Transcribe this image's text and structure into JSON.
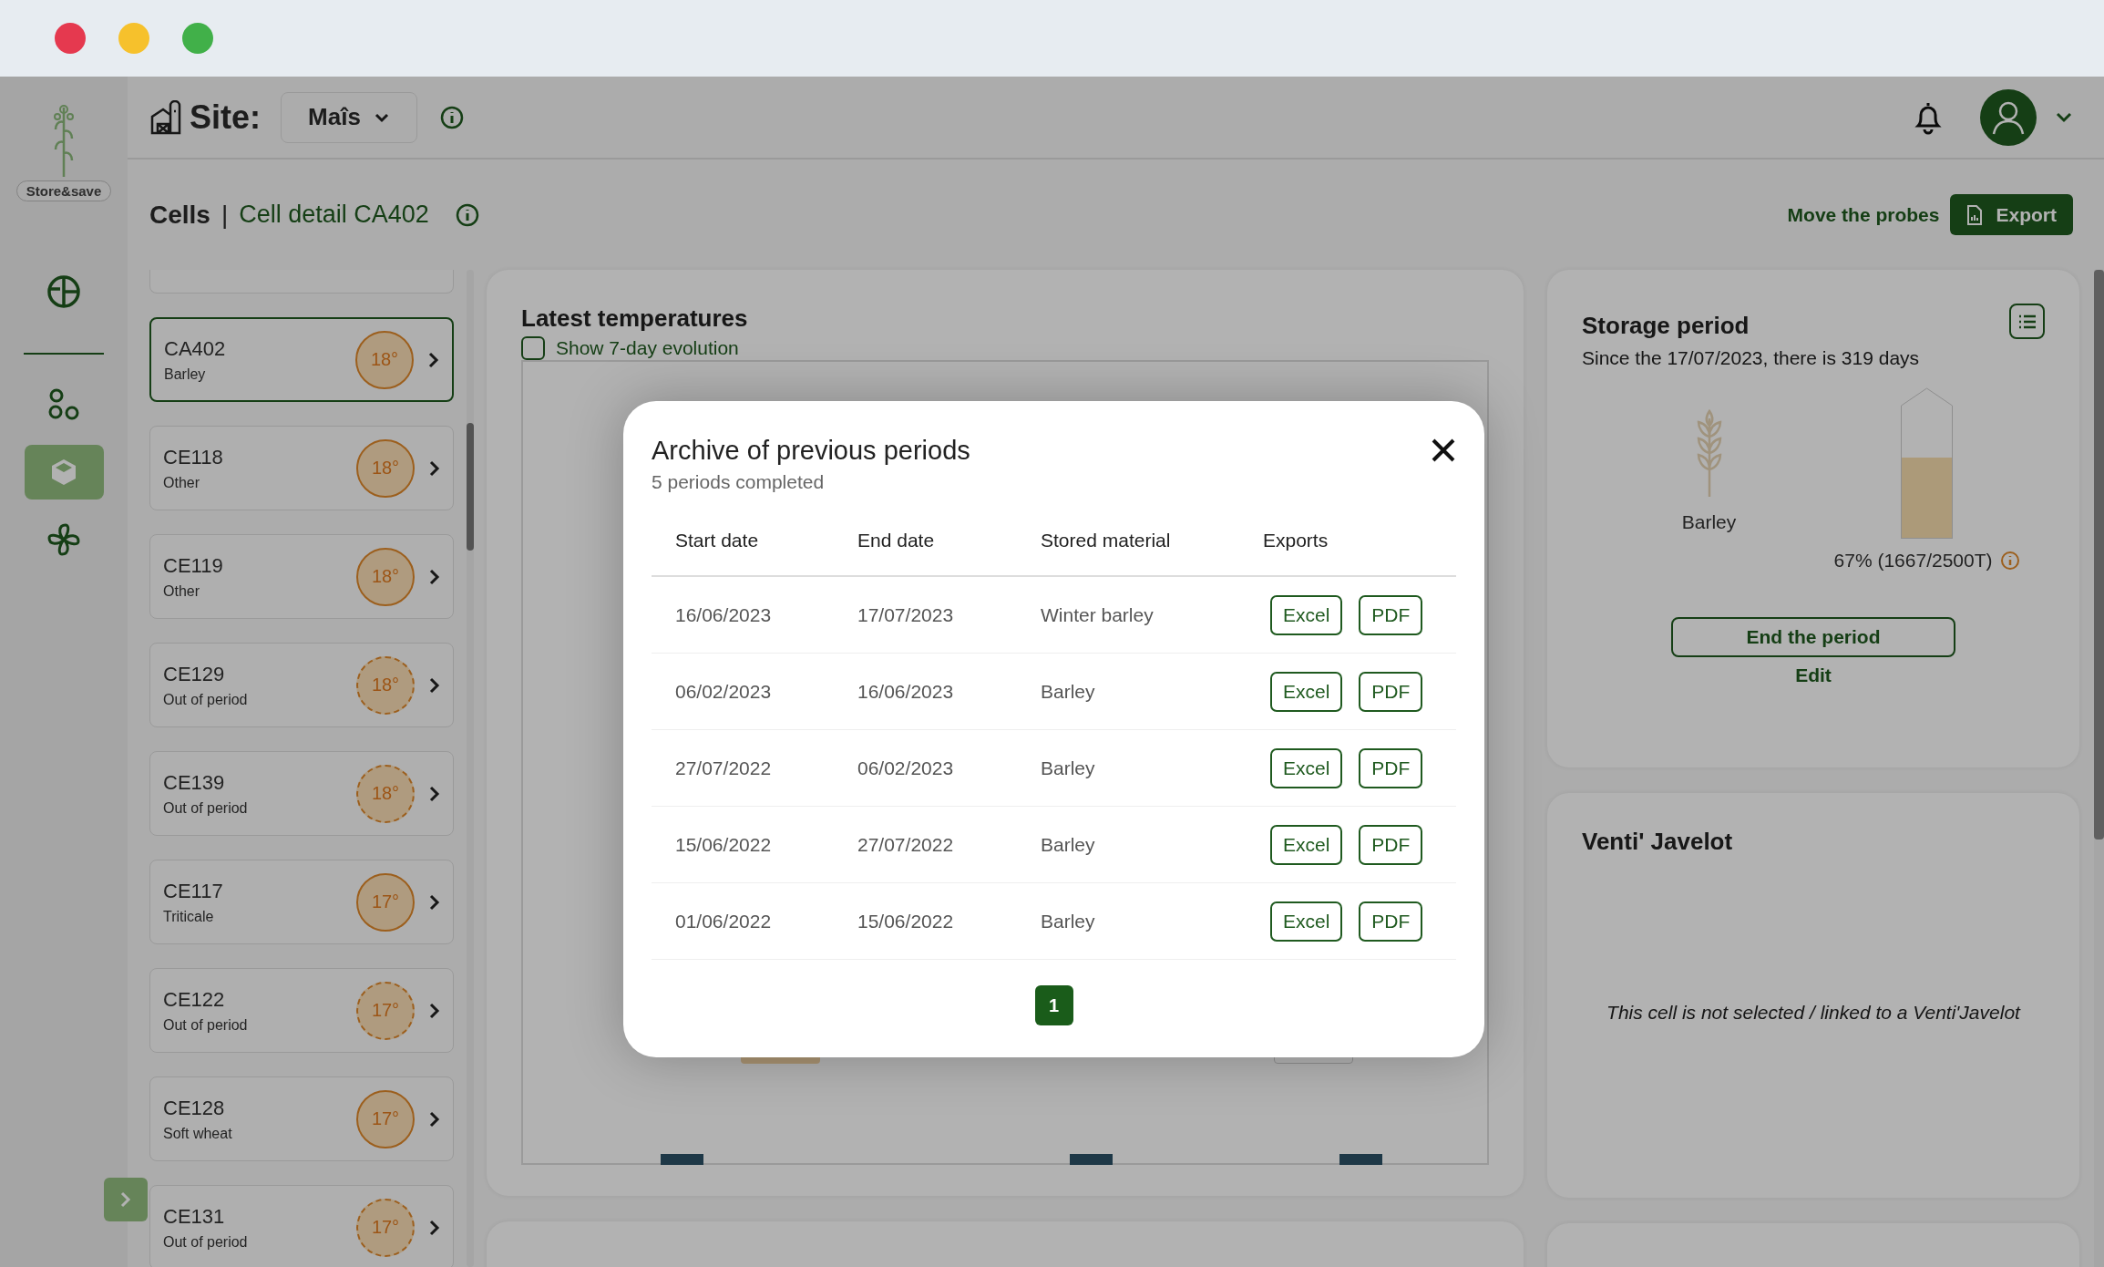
{
  "browser_buttons": [
    {
      "color": "#e5394f"
    },
    {
      "color": "#f6c12c"
    },
    {
      "color": "#41b049"
    }
  ],
  "sidebar": {
    "logo_text": "Store&save",
    "items": [
      {
        "kind": "sectors",
        "selected": false
      },
      {
        "kind": "nodes",
        "selected": false
      },
      {
        "kind": "cube",
        "selected": true
      },
      {
        "kind": "fan",
        "selected": false
      }
    ]
  },
  "header": {
    "site_label": "Site:",
    "site_value": "Maîs"
  },
  "breadcrumb": {
    "root": "Cells",
    "separator": "|",
    "current": "Cell detail CA402"
  },
  "actions": {
    "link": "Move the probes",
    "export": "Export"
  },
  "cells": [
    {
      "code": "CA402",
      "material": "Barley",
      "temperature": "18°",
      "in_period": true,
      "selected": true
    },
    {
      "code": "CE118",
      "material": "Other",
      "temperature": "18°",
      "in_period": true,
      "selected": false
    },
    {
      "code": "CE119",
      "material": "Other",
      "temperature": "18°",
      "in_period": true,
      "selected": false
    },
    {
      "code": "CE129",
      "material": "Out of period",
      "temperature": "18°",
      "in_period": false,
      "selected": false
    },
    {
      "code": "CE139",
      "material": "Out of period",
      "temperature": "18°",
      "in_period": false,
      "selected": false
    },
    {
      "code": "CE117",
      "material": "Triticale",
      "temperature": "17°",
      "in_period": true,
      "selected": false
    },
    {
      "code": "CE122",
      "material": "Out of period",
      "temperature": "17°",
      "in_period": false,
      "selected": false
    },
    {
      "code": "CE128",
      "material": "Soft wheat",
      "temperature": "17°",
      "in_period": true,
      "selected": false
    },
    {
      "code": "CE131",
      "material": "Out of period",
      "temperature": "17°",
      "in_period": false,
      "selected": false
    }
  ],
  "latest_temperatures": {
    "title": "Latest temperatures",
    "checkbox": {
      "label": "Show 7-day evolution",
      "checked": false
    }
  },
  "storage_period": {
    "title": "Storage period",
    "subtitle": "Since the 17/07/2023, there is 319 days",
    "material": "Barley",
    "fill_label": "67% (1667/2500T)",
    "level": 0.67,
    "end_button": "End the period",
    "edit_link": "Edit"
  },
  "venti": {
    "title": "Venti' Javelot",
    "message": "This cell is not selected / linked to a Venti'Javelot"
  },
  "modal": {
    "title": "Archive of previous periods",
    "subtitle": "5 periods completed",
    "columns": [
      "Start date",
      "End date",
      "Stored material",
      "Exports"
    ],
    "rows": [
      {
        "start": "16/06/2023",
        "end": "17/07/2023",
        "material": "Winter barley",
        "exports": [
          "Excel",
          "PDF"
        ]
      },
      {
        "start": "06/02/2023",
        "end": "16/06/2023",
        "material": "Barley",
        "exports": [
          "Excel",
          "PDF"
        ]
      },
      {
        "start": "27/07/2022",
        "end": "06/02/2023",
        "material": "Barley",
        "exports": [
          "Excel",
          "PDF"
        ]
      },
      {
        "start": "15/06/2022",
        "end": "27/07/2022",
        "material": "Barley",
        "exports": [
          "Excel",
          "PDF"
        ]
      },
      {
        "start": "01/06/2022",
        "end": "15/06/2022",
        "material": "Barley",
        "exports": [
          "Excel",
          "PDF"
        ]
      }
    ],
    "pages": [
      {
        "label": "1",
        "selected": true
      }
    ]
  }
}
